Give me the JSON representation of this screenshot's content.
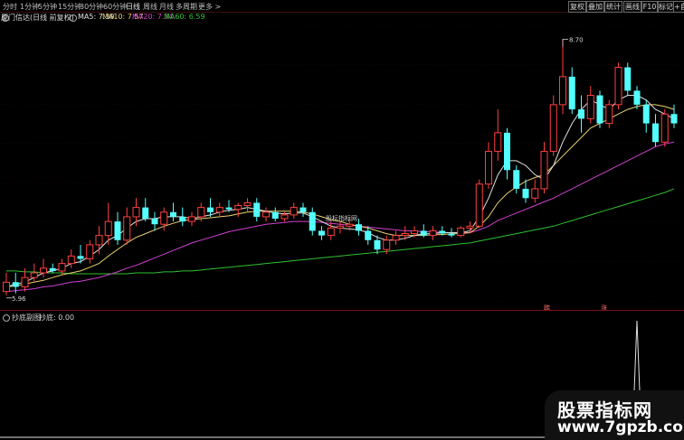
{
  "toolbar": {
    "periods": [
      {
        "label": "分时",
        "active": false
      },
      {
        "label": "1分钟",
        "active": false
      },
      {
        "label": "5分钟",
        "active": false
      },
      {
        "label": "15分钟",
        "active": false
      },
      {
        "label": "30分钟",
        "active": false
      },
      {
        "label": "60分钟",
        "active": false
      },
      {
        "label": "日线",
        "active": true
      },
      {
        "label": "周线",
        "active": false
      },
      {
        "label": "月线",
        "active": false
      },
      {
        "label": "多周期",
        "active": false
      },
      {
        "label": "更多 >",
        "active": false
      }
    ],
    "right_buttons": [
      "复权",
      "叠加",
      "统计",
      "画线",
      "F10",
      "标记",
      "+自"
    ]
  },
  "main_info": {
    "stock_name": "厦门信达(日线 前复权)",
    "ma5_label": "MA5: 7.39",
    "ma10_label": "MA10: 7.57",
    "ma20_label": "MA20: 7.34",
    "ma60_label": "MA60: 6.59",
    "colors": {
      "ma5": "#e0e0e0",
      "ma10": "#e8d070",
      "ma20": "#d040d0",
      "ma60": "#30c030"
    }
  },
  "chart_annotations": {
    "high_label": "8.70",
    "low_label": "5.96",
    "center_watermark": "股标指标网"
  },
  "signals": [
    {
      "label": "踏"
    },
    {
      "label": "涨"
    }
  ],
  "sub_info": {
    "name": "抄底副图",
    "value_label": "抄底: 0.00"
  },
  "brand": {
    "line1": "股票指标网",
    "line2": "www.7gpzb.com"
  },
  "chart_data": {
    "type": "candlestick",
    "y_range": [
      5.96,
      8.7
    ],
    "candles": [
      {
        "o": 6.0,
        "h": 6.2,
        "l": 5.96,
        "c": 6.1,
        "up": true
      },
      {
        "o": 6.1,
        "h": 6.2,
        "l": 5.98,
        "c": 6.05,
        "up": false
      },
      {
        "o": 6.05,
        "h": 6.25,
        "l": 6.0,
        "c": 6.15,
        "up": true
      },
      {
        "o": 6.15,
        "h": 6.3,
        "l": 6.1,
        "c": 6.2,
        "up": true
      },
      {
        "o": 6.2,
        "h": 6.35,
        "l": 6.15,
        "c": 6.25,
        "up": true
      },
      {
        "o": 6.25,
        "h": 6.3,
        "l": 6.2,
        "c": 6.22,
        "up": false
      },
      {
        "o": 6.22,
        "h": 6.35,
        "l": 6.18,
        "c": 6.3,
        "up": true
      },
      {
        "o": 6.3,
        "h": 6.45,
        "l": 6.25,
        "c": 6.38,
        "up": true
      },
      {
        "o": 6.38,
        "h": 6.5,
        "l": 6.3,
        "c": 6.35,
        "up": false
      },
      {
        "o": 6.35,
        "h": 6.55,
        "l": 6.3,
        "c": 6.5,
        "up": true
      },
      {
        "o": 6.5,
        "h": 6.7,
        "l": 6.4,
        "c": 6.6,
        "up": true
      },
      {
        "o": 6.6,
        "h": 6.95,
        "l": 6.5,
        "c": 6.75,
        "up": true
      },
      {
        "o": 6.75,
        "h": 6.85,
        "l": 6.5,
        "c": 6.55,
        "up": false
      },
      {
        "o": 6.55,
        "h": 6.9,
        "l": 6.5,
        "c": 6.8,
        "up": true
      },
      {
        "o": 6.8,
        "h": 7.0,
        "l": 6.7,
        "c": 6.9,
        "up": true
      },
      {
        "o": 6.9,
        "h": 7.0,
        "l": 6.75,
        "c": 6.78,
        "up": false
      },
      {
        "o": 6.78,
        "h": 6.85,
        "l": 6.65,
        "c": 6.72,
        "up": false
      },
      {
        "o": 6.72,
        "h": 6.9,
        "l": 6.65,
        "c": 6.85,
        "up": true
      },
      {
        "o": 6.85,
        "h": 6.95,
        "l": 6.75,
        "c": 6.8,
        "up": false
      },
      {
        "o": 6.8,
        "h": 6.9,
        "l": 6.7,
        "c": 6.75,
        "up": false
      },
      {
        "o": 6.75,
        "h": 6.85,
        "l": 6.7,
        "c": 6.8,
        "up": true
      },
      {
        "o": 6.8,
        "h": 6.95,
        "l": 6.75,
        "c": 6.9,
        "up": true
      },
      {
        "o": 6.9,
        "h": 7.0,
        "l": 6.8,
        "c": 6.85,
        "up": false
      },
      {
        "o": 6.85,
        "h": 6.95,
        "l": 6.8,
        "c": 6.9,
        "up": true
      },
      {
        "o": 6.9,
        "h": 6.98,
        "l": 6.85,
        "c": 6.88,
        "up": false
      },
      {
        "o": 6.88,
        "h": 6.95,
        "l": 6.8,
        "c": 6.92,
        "up": true
      },
      {
        "o": 6.92,
        "h": 7.0,
        "l": 6.85,
        "c": 6.95,
        "up": true
      },
      {
        "o": 6.95,
        "h": 7.0,
        "l": 6.75,
        "c": 6.8,
        "up": false
      },
      {
        "o": 6.8,
        "h": 6.9,
        "l": 6.75,
        "c": 6.85,
        "up": true
      },
      {
        "o": 6.85,
        "h": 6.9,
        "l": 6.75,
        "c": 6.78,
        "up": false
      },
      {
        "o": 6.78,
        "h": 6.85,
        "l": 6.75,
        "c": 6.82,
        "up": true
      },
      {
        "o": 6.82,
        "h": 6.95,
        "l": 6.78,
        "c": 6.9,
        "up": true
      },
      {
        "o": 6.9,
        "h": 6.95,
        "l": 6.8,
        "c": 6.85,
        "up": false
      },
      {
        "o": 6.85,
        "h": 6.9,
        "l": 6.6,
        "c": 6.65,
        "up": false
      },
      {
        "o": 6.65,
        "h": 6.7,
        "l": 6.55,
        "c": 6.6,
        "up": false
      },
      {
        "o": 6.6,
        "h": 6.75,
        "l": 6.55,
        "c": 6.68,
        "up": true
      },
      {
        "o": 6.68,
        "h": 6.75,
        "l": 6.62,
        "c": 6.7,
        "up": true
      },
      {
        "o": 6.7,
        "h": 6.8,
        "l": 6.65,
        "c": 6.72,
        "up": true
      },
      {
        "o": 6.72,
        "h": 6.78,
        "l": 6.6,
        "c": 6.65,
        "up": false
      },
      {
        "o": 6.65,
        "h": 6.7,
        "l": 6.5,
        "c": 6.55,
        "up": false
      },
      {
        "o": 6.55,
        "h": 6.6,
        "l": 6.4,
        "c": 6.45,
        "up": false
      },
      {
        "o": 6.45,
        "h": 6.6,
        "l": 6.4,
        "c": 6.55,
        "up": true
      },
      {
        "o": 6.55,
        "h": 6.65,
        "l": 6.5,
        "c": 6.6,
        "up": true
      },
      {
        "o": 6.6,
        "h": 6.7,
        "l": 6.55,
        "c": 6.62,
        "up": true
      },
      {
        "o": 6.62,
        "h": 6.7,
        "l": 6.58,
        "c": 6.65,
        "up": true
      },
      {
        "o": 6.65,
        "h": 6.72,
        "l": 6.58,
        "c": 6.6,
        "up": false
      },
      {
        "o": 6.6,
        "h": 6.7,
        "l": 6.55,
        "c": 6.65,
        "up": true
      },
      {
        "o": 6.65,
        "h": 6.7,
        "l": 6.6,
        "c": 6.62,
        "up": false
      },
      {
        "o": 6.62,
        "h": 6.68,
        "l": 6.58,
        "c": 6.6,
        "up": false
      },
      {
        "o": 6.6,
        "h": 6.7,
        "l": 6.58,
        "c": 6.68,
        "up": true
      },
      {
        "o": 6.68,
        "h": 6.75,
        "l": 6.62,
        "c": 6.7,
        "up": true
      },
      {
        "o": 6.7,
        "h": 7.2,
        "l": 6.68,
        "c": 7.15,
        "up": true
      },
      {
        "o": 7.15,
        "h": 7.6,
        "l": 7.1,
        "c": 7.5,
        "up": true
      },
      {
        "o": 7.5,
        "h": 7.95,
        "l": 7.4,
        "c": 7.7,
        "up": true
      },
      {
        "o": 7.7,
        "h": 7.75,
        "l": 7.2,
        "c": 7.3,
        "up": false
      },
      {
        "o": 7.3,
        "h": 7.35,
        "l": 7.05,
        "c": 7.1,
        "up": false
      },
      {
        "o": 7.1,
        "h": 7.2,
        "l": 6.95,
        "c": 7.0,
        "up": false
      },
      {
        "o": 7.0,
        "h": 7.2,
        "l": 6.95,
        "c": 7.1,
        "up": true
      },
      {
        "o": 7.1,
        "h": 7.6,
        "l": 7.05,
        "c": 7.5,
        "up": true
      },
      {
        "o": 7.5,
        "h": 8.1,
        "l": 7.45,
        "c": 8.0,
        "up": true
      },
      {
        "o": 8.0,
        "h": 8.7,
        "l": 7.9,
        "c": 8.3,
        "up": true
      },
      {
        "o": 8.3,
        "h": 8.4,
        "l": 7.9,
        "c": 7.95,
        "up": false
      },
      {
        "o": 7.95,
        "h": 8.1,
        "l": 7.7,
        "c": 7.85,
        "up": false
      },
      {
        "o": 7.85,
        "h": 8.2,
        "l": 7.8,
        "c": 8.1,
        "up": true
      },
      {
        "o": 8.1,
        "h": 8.15,
        "l": 7.75,
        "c": 7.8,
        "up": false
      },
      {
        "o": 7.8,
        "h": 8.05,
        "l": 7.75,
        "c": 8.0,
        "up": true
      },
      {
        "o": 8.0,
        "h": 8.45,
        "l": 7.95,
        "c": 8.4,
        "up": true
      },
      {
        "o": 8.4,
        "h": 8.45,
        "l": 8.1,
        "c": 8.15,
        "up": false
      },
      {
        "o": 8.15,
        "h": 8.2,
        "l": 7.95,
        "c": 8.0,
        "up": false
      },
      {
        "o": 8.0,
        "h": 8.05,
        "l": 7.7,
        "c": 7.8,
        "up": false
      },
      {
        "o": 7.8,
        "h": 7.9,
        "l": 7.55,
        "c": 7.6,
        "up": false
      },
      {
        "o": 7.6,
        "h": 7.95,
        "l": 7.55,
        "c": 7.9,
        "up": true
      },
      {
        "o": 7.9,
        "h": 8.0,
        "l": 7.75,
        "c": 7.8,
        "up": false
      }
    ],
    "ma_series": {
      "ma5": [
        6.05,
        6.08,
        6.1,
        6.15,
        6.2,
        6.22,
        6.25,
        6.3,
        6.32,
        6.38,
        6.45,
        6.55,
        6.6,
        6.68,
        6.75,
        6.78,
        6.78,
        6.8,
        6.8,
        6.8,
        6.78,
        6.8,
        6.82,
        6.85,
        6.87,
        6.88,
        6.9,
        6.88,
        6.86,
        6.84,
        6.83,
        6.84,
        6.84,
        6.8,
        6.75,
        6.7,
        6.68,
        6.67,
        6.66,
        6.63,
        6.58,
        6.55,
        6.55,
        6.57,
        6.6,
        6.62,
        6.62,
        6.63,
        6.63,
        6.63,
        6.65,
        6.8,
        7.0,
        7.25,
        7.4,
        7.4,
        7.35,
        7.25,
        7.2,
        7.35,
        7.6,
        7.8,
        7.95,
        8.05,
        8.0,
        7.95,
        8.05,
        8.1,
        8.1,
        8.05,
        7.95,
        7.9,
        7.85
      ],
      "ma10": [
        6.05,
        6.06,
        6.08,
        6.1,
        6.12,
        6.15,
        6.18,
        6.2,
        6.22,
        6.26,
        6.3,
        6.38,
        6.45,
        6.52,
        6.58,
        6.62,
        6.66,
        6.7,
        6.73,
        6.76,
        6.77,
        6.78,
        6.79,
        6.8,
        6.81,
        6.83,
        6.85,
        6.86,
        6.86,
        6.86,
        6.86,
        6.86,
        6.85,
        6.83,
        6.8,
        6.77,
        6.75,
        6.72,
        6.7,
        6.68,
        6.65,
        6.62,
        6.6,
        6.6,
        6.6,
        6.6,
        6.61,
        6.61,
        6.62,
        6.62,
        6.63,
        6.7,
        6.8,
        6.95,
        7.05,
        7.12,
        7.18,
        7.22,
        7.25,
        7.35,
        7.45,
        7.55,
        7.65,
        7.75,
        7.8,
        7.85,
        7.9,
        7.95,
        7.98,
        8.0,
        8.0,
        7.98,
        7.95
      ],
      "ma20": [
        6.0,
        6.01,
        6.02,
        6.03,
        6.05,
        6.06,
        6.08,
        6.1,
        6.11,
        6.13,
        6.15,
        6.18,
        6.21,
        6.25,
        6.28,
        6.32,
        6.36,
        6.4,
        6.44,
        6.48,
        6.52,
        6.55,
        6.58,
        6.61,
        6.64,
        6.66,
        6.68,
        6.7,
        6.72,
        6.73,
        6.74,
        6.75,
        6.75,
        6.75,
        6.74,
        6.73,
        6.72,
        6.71,
        6.7,
        6.69,
        6.68,
        6.67,
        6.66,
        6.65,
        6.65,
        6.64,
        6.64,
        6.63,
        6.63,
        6.63,
        6.63,
        6.66,
        6.7,
        6.76,
        6.8,
        6.84,
        6.88,
        6.92,
        6.96,
        7.0,
        7.05,
        7.1,
        7.15,
        7.2,
        7.25,
        7.3,
        7.35,
        7.4,
        7.45,
        7.5,
        7.55,
        7.58,
        7.6
      ],
      "ma60": [
        6.22,
        6.22,
        6.21,
        6.21,
        6.2,
        6.2,
        6.2,
        6.19,
        6.19,
        6.19,
        6.19,
        6.19,
        6.19,
        6.19,
        6.2,
        6.2,
        6.2,
        6.21,
        6.21,
        6.22,
        6.22,
        6.23,
        6.24,
        6.25,
        6.26,
        6.27,
        6.28,
        6.29,
        6.3,
        6.31,
        6.32,
        6.33,
        6.34,
        6.35,
        6.36,
        6.37,
        6.38,
        6.39,
        6.4,
        6.41,
        6.42,
        6.43,
        6.44,
        6.45,
        6.46,
        6.47,
        6.48,
        6.49,
        6.5,
        6.51,
        6.52,
        6.54,
        6.56,
        6.58,
        6.6,
        6.62,
        6.64,
        6.66,
        6.68,
        6.7,
        6.73,
        6.76,
        6.79,
        6.82,
        6.85,
        6.88,
        6.91,
        6.94,
        6.97,
        7.0,
        7.03,
        7.06,
        7.1
      ]
    },
    "sub_series": {
      "spike_index": 68,
      "spike_value": 1.0
    }
  }
}
